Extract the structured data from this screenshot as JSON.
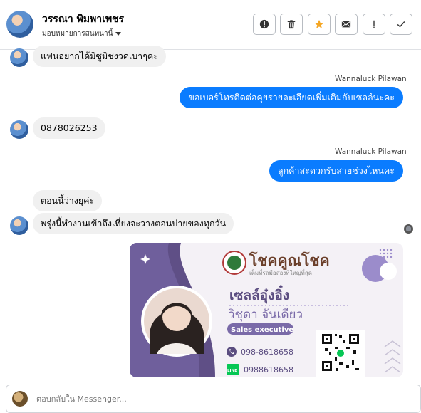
{
  "header": {
    "contact_name": "วรรณา พิมพาเพชร",
    "assign_label": "มอบหมายการสนทนานี้",
    "actions": [
      {
        "name": "report-button",
        "icon": "exclamation-circle-icon",
        "color": "#333333"
      },
      {
        "name": "delete-button",
        "icon": "trash-icon",
        "color": "#333333"
      },
      {
        "name": "star-button",
        "icon": "star-icon",
        "color": "#f5a623"
      },
      {
        "name": "mail-button",
        "icon": "envelope-icon",
        "color": "#333333"
      },
      {
        "name": "important-button",
        "icon": "exclamation-icon",
        "color": "#333333"
      },
      {
        "name": "done-button",
        "icon": "check-icon",
        "color": "#333333"
      }
    ]
  },
  "messages": [
    {
      "direction": "in",
      "text": "แฟนอยากได้มิซูมิชงวดเบาๆคะ"
    },
    {
      "direction": "out",
      "sender": "Wannaluck Pilawan",
      "text": "ขอเบอร์โทรติดต่อคุยรายละเอียดเพิ่มเติมกับเซลล์นะคะ"
    },
    {
      "direction": "in",
      "text": "0878026253"
    },
    {
      "direction": "out",
      "sender": "Wannaluck Pilawan",
      "text": "ลูกค้าสะดวกรับสายช่วงไหนคะ"
    },
    {
      "direction": "in",
      "text": "ตอนนี้ว่างยุค่ะ"
    },
    {
      "direction": "in",
      "text": "พรุ่งนี้ทำงานเข้าถึงเที่ยงจะวางตอนบ่ายของทุกวัน"
    }
  ],
  "card": {
    "brand": "โชคคูณโชค",
    "slogan": "เต็มที่รถมือสองที่ใหญ่ที่สุด",
    "title": "เซลล์อุ๋งอิ๋ง",
    "name": "วิชุดา จันเดียว",
    "role": "Sales executive",
    "phone": "098-8618658",
    "line_badge": "LINE",
    "line_id": "0988618658"
  },
  "composer": {
    "placeholder": "ตอบกลับใน Messenger..."
  },
  "colors": {
    "outgoing_bubble": "#0a7cff",
    "incoming_bubble": "#f0f0f0",
    "card_purple": "#6b5b95"
  }
}
